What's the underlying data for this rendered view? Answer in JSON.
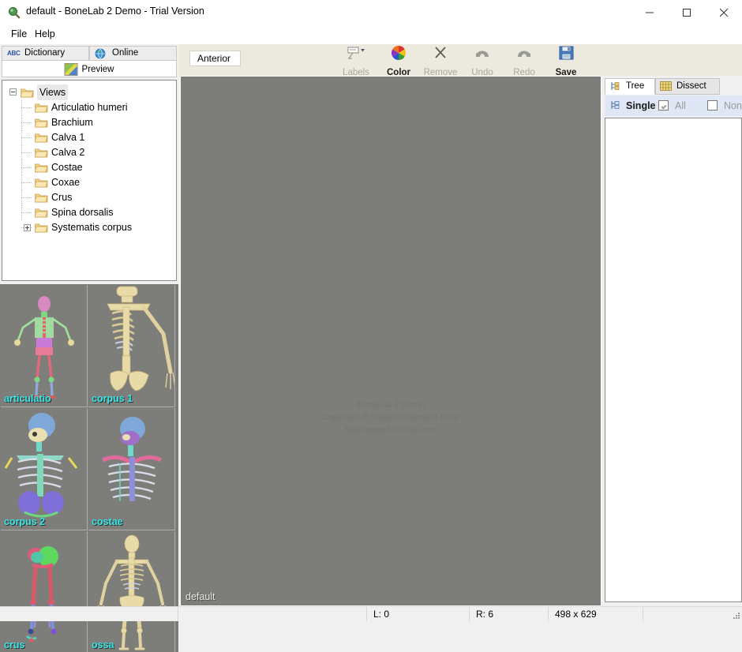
{
  "window": {
    "title": "default - BoneLab 2 Demo - Trial Version",
    "icon": "app-magnifier-icon",
    "minimize": "—",
    "maximize": "□",
    "close": "×"
  },
  "menubar": {
    "items": [
      {
        "label": "File"
      },
      {
        "label": "Help"
      }
    ]
  },
  "left_panel": {
    "tabs": [
      {
        "label": "Dictionary",
        "icon": "abc-icon",
        "active": false
      },
      {
        "label": "Online",
        "icon": "globe-icon",
        "active": false
      }
    ],
    "subtab": {
      "label": "Preview",
      "icon": "preview-image-icon"
    },
    "tree": {
      "root": {
        "label": "Views",
        "expanded": true
      },
      "children": [
        {
          "label": "Articulatio humeri",
          "expandable": false
        },
        {
          "label": "Brachium",
          "expandable": false
        },
        {
          "label": "Calva 1",
          "expandable": false
        },
        {
          "label": "Calva 2",
          "expandable": false
        },
        {
          "label": "Costae",
          "expandable": false
        },
        {
          "label": "Coxae",
          "expandable": false
        },
        {
          "label": "Crus",
          "expandable": false
        },
        {
          "label": "Spina dorsalis",
          "expandable": false
        },
        {
          "label": "Systematis corpus",
          "expandable": true
        }
      ]
    },
    "thumbnails": [
      {
        "label": "articulatio",
        "style": "colored-full-skeleton"
      },
      {
        "label": "corpus 1",
        "style": "bone-torso-arm"
      },
      {
        "label": "corpus 2",
        "style": "colored-upper-body"
      },
      {
        "label": "costae",
        "style": "colored-ribcage"
      },
      {
        "label": "crus",
        "style": "colored-legs"
      },
      {
        "label": "ossa",
        "style": "bone-full-skeleton"
      }
    ]
  },
  "toolbar": {
    "view_selector": {
      "value": "Anterior"
    },
    "buttons": [
      {
        "label": "Labels",
        "icon": "label-tag-icon",
        "enabled": false,
        "dropdown": true
      },
      {
        "label": "Color",
        "icon": "color-palette-icon",
        "enabled": true,
        "dropdown": false
      },
      {
        "label": "Remove",
        "icon": "x-cross-icon",
        "enabled": false,
        "dropdown": false
      },
      {
        "label": "Undo",
        "icon": "undo-arrow-icon",
        "enabled": false,
        "dropdown": false
      },
      {
        "label": "Redo",
        "icon": "redo-arrow-icon",
        "enabled": false,
        "dropdown": false
      },
      {
        "label": "Save",
        "icon": "floppy-disk-icon",
        "enabled": true,
        "dropdown": false
      }
    ]
  },
  "viewport": {
    "background_color": "#7d7d79",
    "watermark": {
      "line1": "BoneLab 2 Demo",
      "line2": "Copyright © Visual Dimension bvba",
      "line3": "http://www.bonelab.com"
    },
    "scene_name": "default"
  },
  "right_panel": {
    "tabs": [
      {
        "label": "Tree",
        "icon": "tree-structure-icon",
        "active": true
      },
      {
        "label": "Dissect",
        "icon": "grid-dissect-icon",
        "active": false
      }
    ],
    "modes": [
      {
        "label": "Single",
        "icon": "tree-structure-icon",
        "type": "mode",
        "selected": true,
        "enabled": true
      },
      {
        "label": "All",
        "type": "checkbox",
        "checked": true,
        "enabled": false
      },
      {
        "label": "Non",
        "type": "checkbox",
        "checked": false,
        "enabled": false
      }
    ],
    "list_items": []
  },
  "statusbar": {
    "cells": [
      "",
      "L: 0",
      "R: 6",
      "498 x 629",
      ""
    ]
  },
  "colors": {
    "toolbar_bg": "#eceade",
    "viewport_gray": "#7d7d79",
    "thumb_label": "#36e8e8",
    "mode_bar_bg": "#dfe7f5",
    "window_bg": "#f0f0f0"
  }
}
